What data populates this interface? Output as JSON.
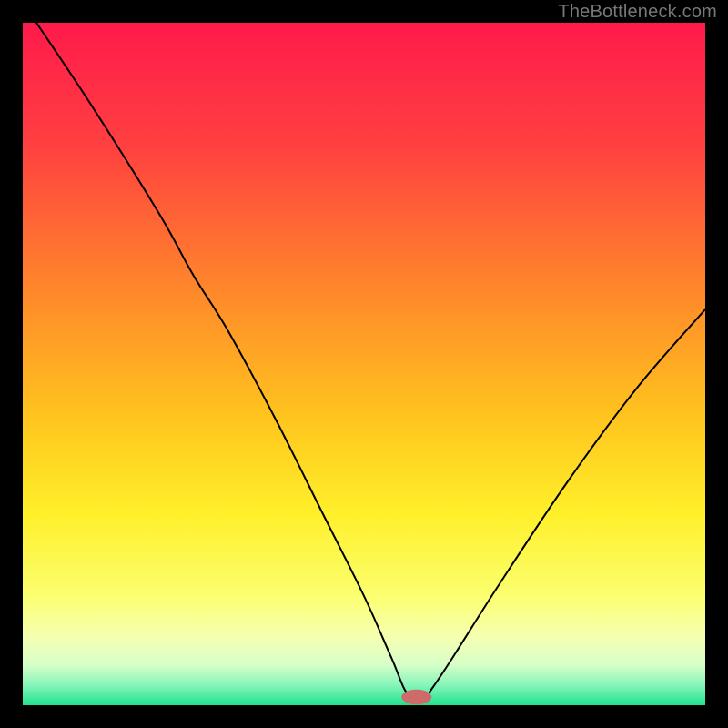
{
  "watermark": "TheBottleneck.com",
  "chart_data": {
    "type": "line",
    "title": "",
    "xlabel": "",
    "ylabel": "",
    "xlim": [
      0,
      100
    ],
    "ylim": [
      0,
      100
    ],
    "grid": false,
    "legend": false,
    "series": [
      {
        "name": "bottleneck-curve",
        "color": "#000000",
        "x": [
          2,
          10,
          20,
          25,
          30,
          37,
          44,
          50,
          54,
          56.5,
          59,
          60,
          63,
          70,
          80,
          90,
          100
        ],
        "values": [
          100,
          88,
          72,
          63,
          55,
          42,
          28,
          16,
          7,
          1.5,
          1.5,
          2.5,
          7,
          18,
          33,
          46.5,
          58
        ]
      }
    ],
    "marker": {
      "name": "optimum-marker",
      "color": "#cf6a6a",
      "x": 57.7,
      "y": 1.2,
      "rx": 2.2,
      "ry": 1.1
    },
    "background_gradient_stops": [
      {
        "offset": 0,
        "color": "#ff1a4b"
      },
      {
        "offset": 18,
        "color": "#ff4040"
      },
      {
        "offset": 40,
        "color": "#ff8a2a"
      },
      {
        "offset": 58,
        "color": "#ffc51e"
      },
      {
        "offset": 72,
        "color": "#fff02a"
      },
      {
        "offset": 84,
        "color": "#fbff70"
      },
      {
        "offset": 90,
        "color": "#f5ffb0"
      },
      {
        "offset": 94,
        "color": "#d8ffc8"
      },
      {
        "offset": 97,
        "color": "#88f5ba"
      },
      {
        "offset": 100,
        "color": "#20e28e"
      }
    ]
  }
}
